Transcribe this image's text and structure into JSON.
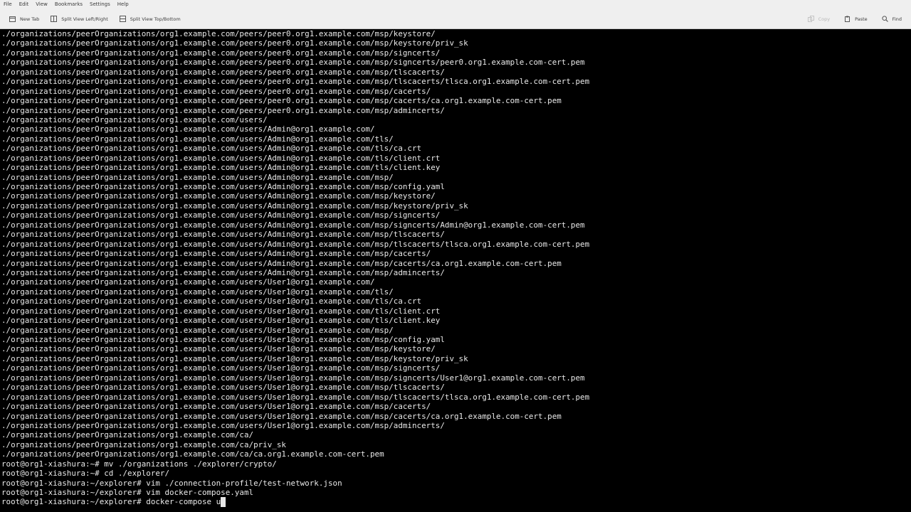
{
  "menubar": {
    "items": [
      "File",
      "Edit",
      "View",
      "Bookmarks",
      "Settings",
      "Help"
    ]
  },
  "toolbar": {
    "new_tab": {
      "label": "New Tab",
      "icon": "new-tab-icon"
    },
    "split_lr": {
      "label": "Split View Left/Right",
      "icon": "split-left-right-icon"
    },
    "split_tb": {
      "label": "Split View Top/Bottom",
      "icon": "split-top-bottom-icon"
    },
    "copy": {
      "label": "Copy",
      "icon": "copy-icon"
    },
    "paste": {
      "label": "Paste",
      "icon": "paste-icon"
    },
    "find": {
      "label": "Find",
      "icon": "search-icon"
    }
  },
  "colors": {
    "terminal_bg": "#000000",
    "terminal_fg": "#e8e8e8",
    "chrome_bg": "#efefef"
  },
  "terminal": {
    "lines": [
      "./organizations/peerOrganizations/org1.example.com/peers/peer0.org1.example.com/msp/keystore/",
      "./organizations/peerOrganizations/org1.example.com/peers/peer0.org1.example.com/msp/keystore/priv_sk",
      "./organizations/peerOrganizations/org1.example.com/peers/peer0.org1.example.com/msp/signcerts/",
      "./organizations/peerOrganizations/org1.example.com/peers/peer0.org1.example.com/msp/signcerts/peer0.org1.example.com-cert.pem",
      "./organizations/peerOrganizations/org1.example.com/peers/peer0.org1.example.com/msp/tlscacerts/",
      "./organizations/peerOrganizations/org1.example.com/peers/peer0.org1.example.com/msp/tlscacerts/tlsca.org1.example.com-cert.pem",
      "./organizations/peerOrganizations/org1.example.com/peers/peer0.org1.example.com/msp/cacerts/",
      "./organizations/peerOrganizations/org1.example.com/peers/peer0.org1.example.com/msp/cacerts/ca.org1.example.com-cert.pem",
      "./organizations/peerOrganizations/org1.example.com/peers/peer0.org1.example.com/msp/admincerts/",
      "./organizations/peerOrganizations/org1.example.com/users/",
      "./organizations/peerOrganizations/org1.example.com/users/Admin@org1.example.com/",
      "./organizations/peerOrganizations/org1.example.com/users/Admin@org1.example.com/tls/",
      "./organizations/peerOrganizations/org1.example.com/users/Admin@org1.example.com/tls/ca.crt",
      "./organizations/peerOrganizations/org1.example.com/users/Admin@org1.example.com/tls/client.crt",
      "./organizations/peerOrganizations/org1.example.com/users/Admin@org1.example.com/tls/client.key",
      "./organizations/peerOrganizations/org1.example.com/users/Admin@org1.example.com/msp/",
      "./organizations/peerOrganizations/org1.example.com/users/Admin@org1.example.com/msp/config.yaml",
      "./organizations/peerOrganizations/org1.example.com/users/Admin@org1.example.com/msp/keystore/",
      "./organizations/peerOrganizations/org1.example.com/users/Admin@org1.example.com/msp/keystore/priv_sk",
      "./organizations/peerOrganizations/org1.example.com/users/Admin@org1.example.com/msp/signcerts/",
      "./organizations/peerOrganizations/org1.example.com/users/Admin@org1.example.com/msp/signcerts/Admin@org1.example.com-cert.pem",
      "./organizations/peerOrganizations/org1.example.com/users/Admin@org1.example.com/msp/tlscacerts/",
      "./organizations/peerOrganizations/org1.example.com/users/Admin@org1.example.com/msp/tlscacerts/tlsca.org1.example.com-cert.pem",
      "./organizations/peerOrganizations/org1.example.com/users/Admin@org1.example.com/msp/cacerts/",
      "./organizations/peerOrganizations/org1.example.com/users/Admin@org1.example.com/msp/cacerts/ca.org1.example.com-cert.pem",
      "./organizations/peerOrganizations/org1.example.com/users/Admin@org1.example.com/msp/admincerts/",
      "./organizations/peerOrganizations/org1.example.com/users/User1@org1.example.com/",
      "./organizations/peerOrganizations/org1.example.com/users/User1@org1.example.com/tls/",
      "./organizations/peerOrganizations/org1.example.com/users/User1@org1.example.com/tls/ca.crt",
      "./organizations/peerOrganizations/org1.example.com/users/User1@org1.example.com/tls/client.crt",
      "./organizations/peerOrganizations/org1.example.com/users/User1@org1.example.com/tls/client.key",
      "./organizations/peerOrganizations/org1.example.com/users/User1@org1.example.com/msp/",
      "./organizations/peerOrganizations/org1.example.com/users/User1@org1.example.com/msp/config.yaml",
      "./organizations/peerOrganizations/org1.example.com/users/User1@org1.example.com/msp/keystore/",
      "./organizations/peerOrganizations/org1.example.com/users/User1@org1.example.com/msp/keystore/priv_sk",
      "./organizations/peerOrganizations/org1.example.com/users/User1@org1.example.com/msp/signcerts/",
      "./organizations/peerOrganizations/org1.example.com/users/User1@org1.example.com/msp/signcerts/User1@org1.example.com-cert.pem",
      "./organizations/peerOrganizations/org1.example.com/users/User1@org1.example.com/msp/tlscacerts/",
      "./organizations/peerOrganizations/org1.example.com/users/User1@org1.example.com/msp/tlscacerts/tlsca.org1.example.com-cert.pem",
      "./organizations/peerOrganizations/org1.example.com/users/User1@org1.example.com/msp/cacerts/",
      "./organizations/peerOrganizations/org1.example.com/users/User1@org1.example.com/msp/cacerts/ca.org1.example.com-cert.pem",
      "./organizations/peerOrganizations/org1.example.com/users/User1@org1.example.com/msp/admincerts/",
      "./organizations/peerOrganizations/org1.example.com/ca/",
      "./organizations/peerOrganizations/org1.example.com/ca/priv_sk",
      "./organizations/peerOrganizations/org1.example.com/ca/ca.org1.example.com-cert.pem",
      "root@org1-xiashura:~# mv ./organizations ./explorer/crypto/",
      "root@org1-xiashura:~# cd ./explorer/",
      "root@org1-xiashura:~/explorer# vim ./connection-profile/test-network.json",
      "root@org1-xiashura:~/explorer# vim docker-compose.yaml"
    ],
    "current_prompt": "root@org1-xiashura:~/explorer# docker-compose u",
    "cursor_char": " "
  }
}
